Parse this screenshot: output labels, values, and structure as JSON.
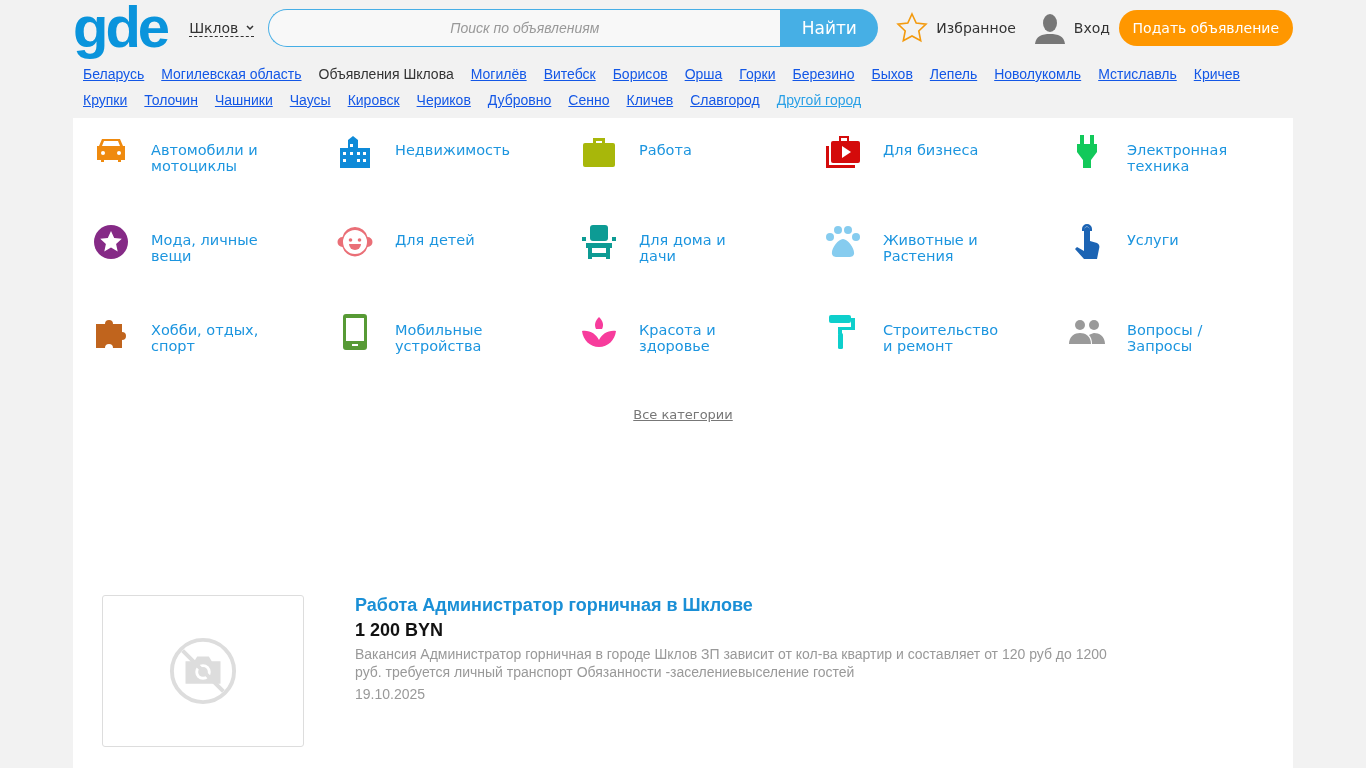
{
  "header": {
    "logo": "gde",
    "city": "Шклов",
    "search": {
      "placeholder": "Поиск по объявлениям",
      "button": "Найти"
    },
    "favorites": "Избранное",
    "login": "Вход",
    "post_button": "Подать объявление"
  },
  "breadcrumbs": [
    {
      "label": "Беларусь",
      "kind": "link"
    },
    {
      "label": "Могилевская область",
      "kind": "link"
    },
    {
      "label": "Объявления Шклова",
      "kind": "current"
    },
    {
      "label": "Могилёв",
      "kind": "link"
    },
    {
      "label": "Витебск",
      "kind": "link"
    },
    {
      "label": "Борисов",
      "kind": "link"
    },
    {
      "label": "Орша",
      "kind": "link"
    },
    {
      "label": "Горки",
      "kind": "link"
    },
    {
      "label": "Березино",
      "kind": "link"
    },
    {
      "label": "Быхов",
      "kind": "link"
    },
    {
      "label": "Лепель",
      "kind": "link"
    },
    {
      "label": "Новолукомль",
      "kind": "link"
    },
    {
      "label": "Мстиславль",
      "kind": "link"
    },
    {
      "label": "Кричев",
      "kind": "link"
    },
    {
      "label": "Крупки",
      "kind": "link"
    },
    {
      "label": "Толочин",
      "kind": "link"
    },
    {
      "label": "Чашники",
      "kind": "link"
    },
    {
      "label": "Чаусы",
      "kind": "link"
    },
    {
      "label": "Кировск",
      "kind": "link"
    },
    {
      "label": "Чериков",
      "kind": "link"
    },
    {
      "label": "Дубровно",
      "kind": "link"
    },
    {
      "label": "Сенно",
      "kind": "link"
    },
    {
      "label": "Кличев",
      "kind": "link"
    },
    {
      "label": "Славгород",
      "kind": "link"
    },
    {
      "label": "Другой город",
      "kind": "other"
    }
  ],
  "categories": [
    {
      "label": "Автомобили и\nмотоциклы",
      "kind": "car",
      "color": "#ef8a0e"
    },
    {
      "label": "Недвижимость",
      "kind": "building",
      "color": "#0e8ad8"
    },
    {
      "label": "Работа",
      "kind": "briefcase",
      "color": "#a8b70a"
    },
    {
      "label": "Для бизнеса",
      "kind": "video",
      "color": "#d40b0b"
    },
    {
      "label": "Электронная\nтехника",
      "kind": "plug",
      "color": "#12c95a"
    },
    {
      "label": "Мода, личные\nвещи",
      "kind": "star",
      "color": "#852a86"
    },
    {
      "label": "Для детей",
      "kind": "baby",
      "color": "#ea6f77"
    },
    {
      "label": "Для дома и\nдачи",
      "kind": "chair",
      "color": "#0d9b94"
    },
    {
      "label": "Животные и\nРастения",
      "kind": "paw",
      "color": "#86ccef"
    },
    {
      "label": "Услуги",
      "kind": "hand",
      "color": "#1c64b4"
    },
    {
      "label": "Хобби, отдых,\nспорт",
      "kind": "puzzle",
      "color": "#c0641d"
    },
    {
      "label": "Мобильные\nустройства",
      "kind": "phone",
      "color": "#579a35"
    },
    {
      "label": "Красота и\nздоровье",
      "kind": "lotus",
      "color": "#f73c9c"
    },
    {
      "label": "Строительство\nи ремонт",
      "kind": "roller",
      "color": "#0ecfcc"
    },
    {
      "label": "Вопросы /\nЗапросы",
      "kind": "people",
      "color": "#9a9a9a"
    }
  ],
  "all_categories": "Все категории",
  "listings": [
    {
      "title": "Работа Администратор горничная в Шклове",
      "price": "1 200 BYN",
      "description": "Вакансия Администратор горничная в городе Шклов ЗП зависит от кол-ва квартир и составляет от 120 руб до 1200 руб. требуется личный транспорт Обязанности -заселениевыселение гостей",
      "date": "19.10.2025"
    }
  ]
}
